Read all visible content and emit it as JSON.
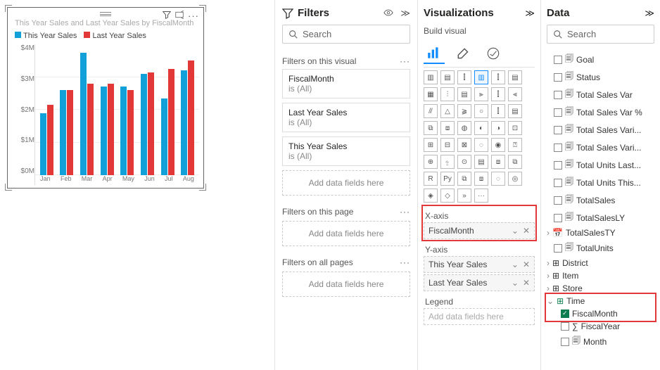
{
  "colors": {
    "series1": "#11a0d7",
    "series2": "#e23838"
  },
  "chart_data": {
    "type": "bar",
    "title": "This Year Sales and Last Year Sales by FiscalMonth",
    "categories": [
      "Jan",
      "Feb",
      "Mar",
      "Apr",
      "May",
      "Jun",
      "Jul",
      "Aug"
    ],
    "series": [
      {
        "name": "This Year Sales",
        "values": [
          1900000,
          2600000,
          3750000,
          2700000,
          2700000,
          3100000,
          2350000,
          3200000
        ]
      },
      {
        "name": "Last Year Sales",
        "values": [
          2150000,
          2600000,
          2800000,
          2800000,
          2600000,
          3150000,
          3250000,
          3500000
        ]
      }
    ],
    "yticks": [
      "$0M",
      "$1M",
      "$2M",
      "$3M",
      "$4M"
    ],
    "ylim": [
      0,
      4000000
    ]
  },
  "filters": {
    "title": "Filters",
    "search_ph": "Search",
    "sec_visual": "Filters on this visual",
    "sec_page": "Filters on this page",
    "sec_all": "Filters on all pages",
    "add": "Add data fields here",
    "cards": [
      {
        "name": "FiscalMonth",
        "cond": "is (All)"
      },
      {
        "name": "Last Year Sales",
        "cond": "is (All)"
      },
      {
        "name": "This Year Sales",
        "cond": "is (All)"
      }
    ]
  },
  "viz": {
    "title": "Visualizations",
    "sub": "Build visual",
    "xaxis": "X-axis",
    "yaxis": "Y-axis",
    "legend": "Legend",
    "xfield": "FiscalMonth",
    "yfields": [
      "This Year Sales",
      "Last Year Sales"
    ],
    "add": "Add data fields here"
  },
  "data": {
    "title": "Data",
    "search_ph": "Search",
    "fields": [
      "Goal",
      "Status",
      "Total Sales Var",
      "Total Sales Var %",
      "Total Sales Vari...",
      "Total Sales Vari...",
      "Total Units Last...",
      "Total Units This...",
      "TotalSales",
      "TotalSalesLY",
      "TotalSalesTY",
      "TotalUnits"
    ],
    "tables": [
      "District",
      "Item",
      "Store",
      "Time"
    ],
    "time_children": [
      "FiscalMonth",
      "FiscalYear",
      "Month"
    ]
  }
}
